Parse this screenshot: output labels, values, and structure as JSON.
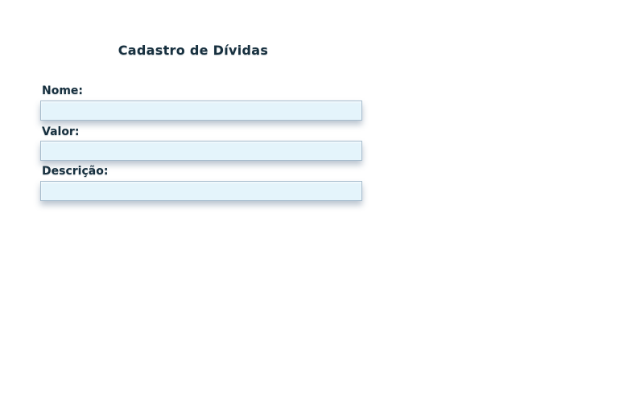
{
  "form": {
    "title": "Cadastro de Dívidas",
    "fields": [
      {
        "label": "Nome:",
        "value": "",
        "placeholder": ""
      },
      {
        "label": "Valor:",
        "value": "",
        "placeholder": ""
      },
      {
        "label": "Descrição:",
        "value": "",
        "placeholder": ""
      }
    ]
  },
  "colors": {
    "text": "#17303f",
    "input_background": "#e4f4fb",
    "input_border": "#a6bccd",
    "page_background": "#ffffff"
  }
}
